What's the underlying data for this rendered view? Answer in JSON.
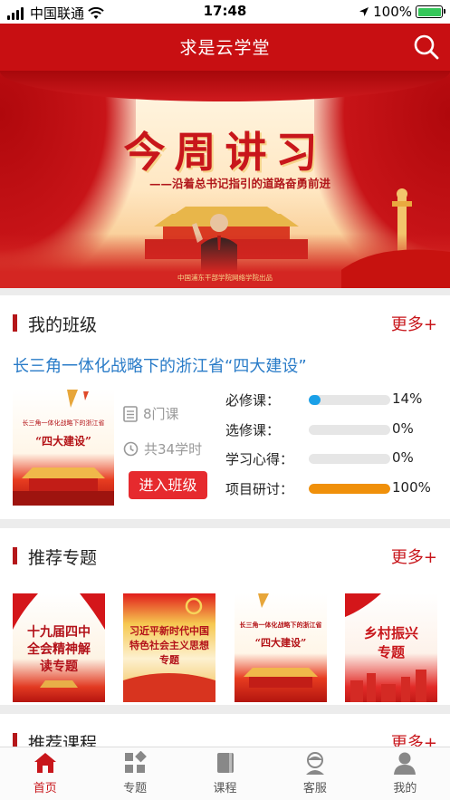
{
  "status_bar": {
    "carrier": "中国联通",
    "time": "17:48",
    "battery": "100%"
  },
  "header": {
    "title": "求是云学堂"
  },
  "banner": {
    "title": "今周讲习",
    "subtitle": "——沿着总书记指引的道路奋勇前进",
    "footer": "中国浦东干部学院网络学院出品"
  },
  "my_class": {
    "section_title": "我的班级",
    "more_label": "更多+",
    "class_name": "长三角一体化战略下的浙江省“四大建设”",
    "thumb_line1": "长三角一体化战略下的浙江省",
    "thumb_line2": "“四大建设”",
    "course_count": "8门课",
    "total_hours": "共34学时",
    "enter_label": "进入班级",
    "progress": [
      {
        "label": "必修课：",
        "value": "14%",
        "fraction": 0.14,
        "color": "#1aa0e8"
      },
      {
        "label": "选修课：",
        "value": "0%",
        "fraction": 0,
        "color": "#1aa0e8"
      },
      {
        "label": "学习心得：",
        "value": "0%",
        "fraction": 0,
        "color": "#1aa0e8"
      },
      {
        "label": "项目研讨：",
        "value": "100%",
        "fraction": 1,
        "color": "#f0900a"
      }
    ]
  },
  "topics": {
    "section_title": "推荐专题",
    "more_label": "更多+",
    "items": [
      {
        "title": "十九届四中全会精神解读专题"
      },
      {
        "title": "习近平新时代中国特色社会主义思想专题"
      },
      {
        "line1": "长三角一体化战略下的浙江省",
        "line2": "“四大建设”"
      },
      {
        "title": "乡村振兴专题"
      }
    ]
  },
  "courses": {
    "section_title": "推荐课程",
    "more_label": "更多+"
  },
  "tab_bar": {
    "items": [
      {
        "label": "首页",
        "icon": "home-icon"
      },
      {
        "label": "专题",
        "icon": "grid-icon"
      },
      {
        "label": "课程",
        "icon": "book-icon"
      },
      {
        "label": "客服",
        "icon": "customer-service-icon"
      },
      {
        "label": "我的",
        "icon": "user-icon"
      }
    ]
  }
}
